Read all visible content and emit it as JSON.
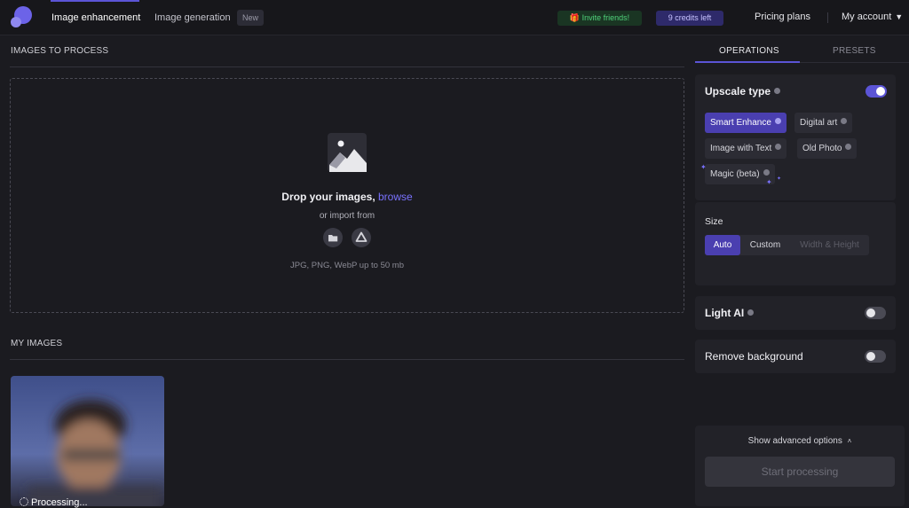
{
  "header": {
    "nav": [
      {
        "label": "Image enhancement",
        "active": true
      },
      {
        "label": "Image generation",
        "badge": "New"
      }
    ],
    "invite": "🎁 Invite friends!",
    "credits": "9 credits left",
    "pricing": "Pricing plans",
    "account": "My account"
  },
  "main": {
    "images_to_process": "IMAGES TO PROCESS",
    "dropzone": {
      "title": "Drop your images,",
      "browse": "browse",
      "import_text": "or import from",
      "hint": "JPG, PNG, WebP up to 50 mb",
      "import_sources": [
        "folder-icon",
        "google-drive-icon"
      ]
    },
    "my_images": "MY IMAGES",
    "thumbnail_status": "Processing..."
  },
  "panel": {
    "tabs": [
      {
        "label": "OPERATIONS",
        "active": true
      },
      {
        "label": "PRESETS",
        "active": false
      }
    ],
    "upscale": {
      "title": "Upscale type",
      "enabled": true,
      "options": [
        {
          "label": "Smart Enhance",
          "selected": true
        },
        {
          "label": "Digital art",
          "selected": false
        },
        {
          "label": "Image with Text",
          "selected": false
        },
        {
          "label": "Old Photo",
          "selected": false
        },
        {
          "label": "Magic (beta)",
          "selected": false
        }
      ]
    },
    "size": {
      "title": "Size",
      "options": [
        {
          "label": "Auto",
          "selected": true
        },
        {
          "label": "Custom",
          "selected": false
        },
        {
          "label": "Width & Height",
          "disabled": true
        }
      ]
    },
    "light_ai": {
      "title": "Light AI",
      "enabled": false
    },
    "remove_background": {
      "title": "Remove background",
      "enabled": false
    },
    "advanced": "Show advanced options",
    "start": "Start processing"
  },
  "colors": {
    "accent": "#5b54d6",
    "accent_chip": "#4a3fb0",
    "invite_green": "#4fd27a",
    "background": "#1b1b20"
  }
}
